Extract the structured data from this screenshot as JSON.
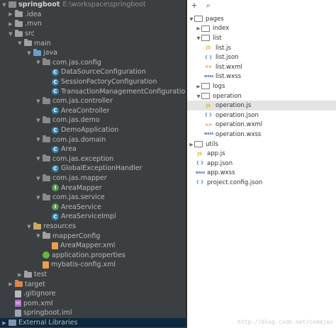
{
  "left_tree": {
    "root": {
      "label": "springboot",
      "path": "E:\\workspace\\springboot"
    },
    "idea": ".idea",
    "mvn": ".mvn",
    "src": "src",
    "main": "main",
    "java": "java",
    "pkg_config": "com.jas.config",
    "cls_datasource": "DataSourceConfiguration",
    "cls_sessionfactory": "SessionFactoryConfiguration",
    "cls_transaction": "TransactionManagementConfiguration",
    "pkg_controller": "com.jas.controller",
    "cls_areacontroller": "AreaController",
    "pkg_demo": "com.jas.demo",
    "cls_demoapp": "DemoApplication",
    "pkg_domain": "com.jas.domain",
    "cls_area": "Area",
    "pkg_exception": "com.jas.exception",
    "cls_globalexc": "GlobalExceptionHandler",
    "pkg_mapper": "com.jas.mapper",
    "intf_areamapper": "AreaMapper",
    "pkg_service": "com.jas.service",
    "intf_areaservice": "AreaService",
    "cls_areaserviceimpl": "AreaServiceImpl",
    "resources": "resources",
    "mapperconfig": "mapperConfig",
    "file_areamapperxml": "AreaMapper.xml",
    "file_appprops": "application.properties",
    "file_mybatis": "mybatis-config.xml",
    "test": "test",
    "target": "target",
    "gitignore": ".gitignore",
    "pomxml": "pom.xml",
    "iml": "springboot.iml",
    "extlibs": "External Libraries"
  },
  "right_tree": {
    "toolbar": {
      "add": "+",
      "search": "⌕"
    },
    "pages": "pages",
    "index": "index",
    "list": "list",
    "list_js": "list.js",
    "list_json": "list.json",
    "list_wxml": "list.wxml",
    "list_wxss": "list.wxss",
    "logs": "logs",
    "operation": "operation",
    "op_js": "operation.js",
    "op_json": "operation.json",
    "op_wxml": "operation.wxml",
    "op_wxss": "operation.wxss",
    "utils": "utils",
    "app_js": "app.js",
    "app_json": "app.json",
    "app_wxss": "app.wxss",
    "project_config": "project.config.json",
    "type_js": "JS",
    "type_json": "{ }",
    "type_wxml": "<>",
    "type_wxss": "wxss"
  },
  "watermark": "http://blog.csdn.net/codejas"
}
